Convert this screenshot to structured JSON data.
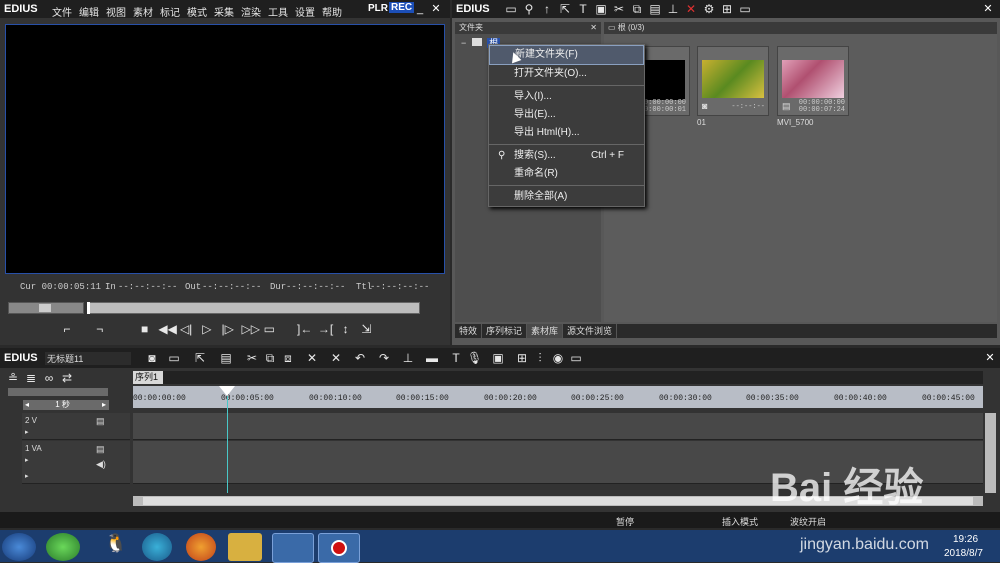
{
  "player": {
    "logo": "EDIUS",
    "menu": [
      "文件",
      "编辑",
      "视图",
      "素材",
      "标记",
      "模式",
      "采集",
      "渲染",
      "工具",
      "设置",
      "帮助"
    ],
    "plr": "PLR",
    "rec": "REC",
    "cur_label": "Cur",
    "cur_value": "00:00:05:11",
    "in_label": "In",
    "in_value": "--:--:--:--",
    "out_label": "Out",
    "out_value": "--:--:--:--",
    "dur_label": "Dur",
    "dur_value": "--:--:--:--",
    "ttl_label": "Ttl",
    "ttl_value": "--:--:--:--"
  },
  "bin": {
    "logo": "EDIUS",
    "folder_header": "文件夹",
    "root_folder": "根",
    "clips_header": "根 (0/3)",
    "clips": [
      {
        "name": "",
        "tc1": "00:00:00:00",
        "tc2": "00:00:00:01",
        "thumb_color": "#000000"
      },
      {
        "name": "01",
        "tc1": "",
        "tc2": "--:--:--",
        "thumb_color": "#8aa040"
      },
      {
        "name": "MVI_5700",
        "tc1": "00:00:00:00",
        "tc2": "00:00:07:24",
        "thumb_color": "#c88aa8"
      }
    ],
    "tabs": [
      "特效",
      "序列标记",
      "素材库",
      "源文件浏览"
    ],
    "active_tab": 2
  },
  "context_menu": {
    "items": [
      {
        "label": "新建文件夹(F)",
        "shortcut": ""
      },
      {
        "label": "打开文件夹(O)...",
        "shortcut": ""
      },
      {
        "label": "导入(I)...",
        "shortcut": ""
      },
      {
        "label": "导出(E)...",
        "shortcut": ""
      },
      {
        "label": "导出 Html(H)...",
        "shortcut": ""
      },
      {
        "label": "搜索(S)...",
        "shortcut": "Ctrl + F"
      },
      {
        "label": "重命名(R)",
        "shortcut": ""
      },
      {
        "label": "删除全部(A)",
        "shortcut": ""
      }
    ]
  },
  "timeline": {
    "logo": "EDIUS",
    "project": "无标题11",
    "sequence_tab": "序列1",
    "scale": "1 秒",
    "ruler": [
      "00:00:00:00",
      "00:00:05:00",
      "00:00:10:00",
      "00:00:15:00",
      "00:00:20:00",
      "00:00:25:00",
      "00:00:30:00",
      "00:00:35:00",
      "00:00:40:00",
      "00:00:45:00"
    ],
    "tracks": [
      {
        "name": "2 V"
      },
      {
        "name": "1 VA"
      }
    ],
    "status": [
      "暂停",
      "插入模式",
      "波纹开启"
    ]
  },
  "taskbar": {
    "time": "19:26",
    "date": "2018/8/7"
  },
  "watermark": {
    "text": "Bai 经验",
    "url": "jingyan.baidu.com"
  },
  "colors": {
    "accent_blue": "#1f4fa8",
    "rec_bg": "#1c4fb8",
    "playhead": "#49c8c8"
  }
}
